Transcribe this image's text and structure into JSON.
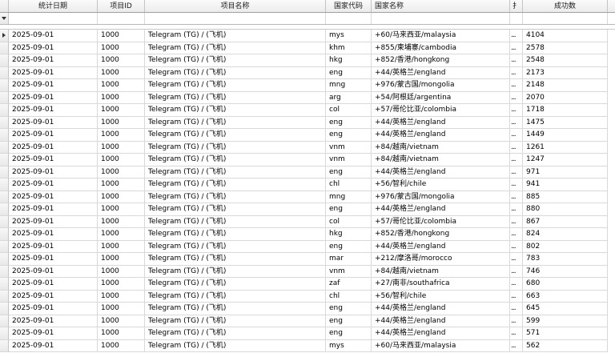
{
  "columns": {
    "date": "统计日期",
    "project_id": "项目ID",
    "project_name": "项目名称",
    "country_code": "国家代码",
    "country_name": "国家名称",
    "truncated": "扌",
    "success_count": "成功数"
  },
  "rows": [
    {
      "date": "2025-09-01",
      "project_id": "1000",
      "project_name": "Telegram (TG) / (飞机)",
      "country_code": "mys",
      "country_name": "+60/马来西亚/malaysia",
      "truncated": "...",
      "success_count": "4104"
    },
    {
      "date": "2025-09-01",
      "project_id": "1000",
      "project_name": "Telegram (TG) / (飞机)",
      "country_code": "khm",
      "country_name": "+855/柬埔寨/cambodia",
      "truncated": "...",
      "success_count": "2578"
    },
    {
      "date": "2025-09-01",
      "project_id": "1000",
      "project_name": "Telegram (TG) / (飞机)",
      "country_code": "hkg",
      "country_name": "+852/香港/hongkong",
      "truncated": "...",
      "success_count": "2548"
    },
    {
      "date": "2025-09-01",
      "project_id": "1000",
      "project_name": "Telegram (TG) / (飞机)",
      "country_code": "eng",
      "country_name": "+44/英格兰/england",
      "truncated": "...",
      "success_count": "2173"
    },
    {
      "date": "2025-09-01",
      "project_id": "1000",
      "project_name": "Telegram (TG) / (飞机)",
      "country_code": "mng",
      "country_name": "+976/蒙古国/mongolia",
      "truncated": "...",
      "success_count": "2148"
    },
    {
      "date": "2025-09-01",
      "project_id": "1000",
      "project_name": "Telegram (TG) / (飞机)",
      "country_code": "arg",
      "country_name": "+54/阿根廷/argentina",
      "truncated": "...",
      "success_count": "2070"
    },
    {
      "date": "2025-09-01",
      "project_id": "1000",
      "project_name": "Telegram (TG) / (飞机)",
      "country_code": "col",
      "country_name": "+57/哥伦比亚/colombia",
      "truncated": "...",
      "success_count": "1718"
    },
    {
      "date": "2025-09-01",
      "project_id": "1000",
      "project_name": "Telegram (TG) / (飞机)",
      "country_code": "eng",
      "country_name": "+44/英格兰/england",
      "truncated": "...",
      "success_count": "1475"
    },
    {
      "date": "2025-09-01",
      "project_id": "1000",
      "project_name": "Telegram (TG) / (飞机)",
      "country_code": "eng",
      "country_name": "+44/英格兰/england",
      "truncated": "...",
      "success_count": "1449"
    },
    {
      "date": "2025-09-01",
      "project_id": "1000",
      "project_name": "Telegram (TG) / (飞机)",
      "country_code": "vnm",
      "country_name": "+84/越南/vietnam",
      "truncated": "...",
      "success_count": "1261"
    },
    {
      "date": "2025-09-01",
      "project_id": "1000",
      "project_name": "Telegram (TG) / (飞机)",
      "country_code": "vnm",
      "country_name": "+84/越南/vietnam",
      "truncated": "...",
      "success_count": "1247"
    },
    {
      "date": "2025-09-01",
      "project_id": "1000",
      "project_name": "Telegram (TG) / (飞机)",
      "country_code": "eng",
      "country_name": "+44/英格兰/england",
      "truncated": "...",
      "success_count": "971"
    },
    {
      "date": "2025-09-01",
      "project_id": "1000",
      "project_name": "Telegram (TG) / (飞机)",
      "country_code": "chl",
      "country_name": "+56/智利/chile",
      "truncated": "...",
      "success_count": "941"
    },
    {
      "date": "2025-09-01",
      "project_id": "1000",
      "project_name": "Telegram (TG) / (飞机)",
      "country_code": "mng",
      "country_name": "+976/蒙古国/mongolia",
      "truncated": "...",
      "success_count": "885"
    },
    {
      "date": "2025-09-01",
      "project_id": "1000",
      "project_name": "Telegram (TG) / (飞机)",
      "country_code": "eng",
      "country_name": "+44/英格兰/england",
      "truncated": "...",
      "success_count": "880"
    },
    {
      "date": "2025-09-01",
      "project_id": "1000",
      "project_name": "Telegram (TG) / (飞机)",
      "country_code": "col",
      "country_name": "+57/哥伦比亚/colombia",
      "truncated": "...",
      "success_count": "867"
    },
    {
      "date": "2025-09-01",
      "project_id": "1000",
      "project_name": "Telegram (TG) / (飞机)",
      "country_code": "hkg",
      "country_name": "+852/香港/hongkong",
      "truncated": "...",
      "success_count": "824"
    },
    {
      "date": "2025-09-01",
      "project_id": "1000",
      "project_name": "Telegram (TG) / (飞机)",
      "country_code": "eng",
      "country_name": "+44/英格兰/england",
      "truncated": "...",
      "success_count": "802"
    },
    {
      "date": "2025-09-01",
      "project_id": "1000",
      "project_name": "Telegram (TG) / (飞机)",
      "country_code": "mar",
      "country_name": "+212/摩洛哥/morocco",
      "truncated": "...",
      "success_count": "783"
    },
    {
      "date": "2025-09-01",
      "project_id": "1000",
      "project_name": "Telegram (TG) / (飞机)",
      "country_code": "vnm",
      "country_name": "+84/越南/vietnam",
      "truncated": "...",
      "success_count": "746"
    },
    {
      "date": "2025-09-01",
      "project_id": "1000",
      "project_name": "Telegram (TG) / (飞机)",
      "country_code": "zaf",
      "country_name": "+27/南非/southafrica",
      "truncated": "...",
      "success_count": "680"
    },
    {
      "date": "2025-09-01",
      "project_id": "1000",
      "project_name": "Telegram (TG) / (飞机)",
      "country_code": "chl",
      "country_name": "+56/智利/chile",
      "truncated": "...",
      "success_count": "663"
    },
    {
      "date": "2025-09-01",
      "project_id": "1000",
      "project_name": "Telegram (TG) / (飞机)",
      "country_code": "eng",
      "country_name": "+44/英格兰/england",
      "truncated": "...",
      "success_count": "645"
    },
    {
      "date": "2025-09-01",
      "project_id": "1000",
      "project_name": "Telegram (TG) / (飞机)",
      "country_code": "eng",
      "country_name": "+44/英格兰/england",
      "truncated": "...",
      "success_count": "599"
    },
    {
      "date": "2025-09-01",
      "project_id": "1000",
      "project_name": "Telegram (TG) / (飞机)",
      "country_code": "eng",
      "country_name": "+44/英格兰/england",
      "truncated": "...",
      "success_count": "571"
    },
    {
      "date": "2025-09-01",
      "project_id": "1000",
      "project_name": "Telegram (TG) / (飞机)",
      "country_code": "mys",
      "country_name": "+60/马来西亚/malaysia",
      "truncated": "...",
      "success_count": "562"
    }
  ],
  "icons": {
    "filter": "filter-icon",
    "row_indicator": "current-row-caret-icon"
  }
}
